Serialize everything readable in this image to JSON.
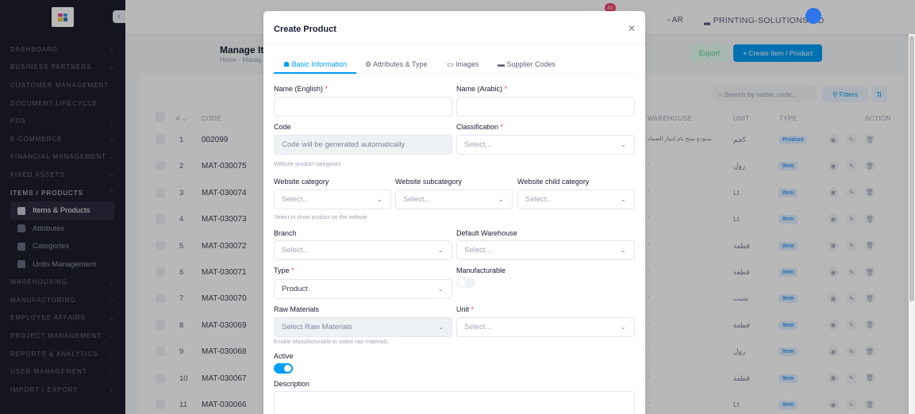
{
  "sidebar": {
    "sections": [
      {
        "label": "DASHBOARD"
      },
      {
        "label": "BUSINESS PARTNERS"
      },
      {
        "label": "CUSTOMER MANAGEMENT"
      },
      {
        "label": "DOCUMENT LIFECYCLE"
      },
      {
        "label": "POS"
      },
      {
        "label": "E-COMMERCE"
      },
      {
        "label": "FINANCIAL MANAGEMENT"
      },
      {
        "label": "FIXED ASSETS"
      },
      {
        "label": "ITEMS / PRODUCTS"
      }
    ],
    "items_sub": [
      {
        "label": "Items & Products"
      },
      {
        "label": "Attributes"
      },
      {
        "label": "Categories"
      },
      {
        "label": "Units Management"
      }
    ],
    "sections_after": [
      {
        "label": "WAREHOUSING"
      },
      {
        "label": "MANUFACTURING"
      },
      {
        "label": "EMPLOYEE AFFAIRS"
      },
      {
        "label": "PROJECT MANAGEMENT"
      },
      {
        "label": "REPORTS & ANALYTICS"
      },
      {
        "label": "USER MANAGEMENT"
      },
      {
        "label": "IMPORT / EXPORT"
      }
    ]
  },
  "topbar": {
    "notification_count": "41",
    "language": "AR",
    "company": "PRINTING-SOLUTIONS-CO"
  },
  "page": {
    "title": "Manage Ite",
    "breadcrumb": "Home - Manag",
    "export_label": "Export",
    "create_label": "+ Create Item / Product",
    "search_placeholder": "Search by name, code...",
    "filters_label": "Filters"
  },
  "table": {
    "headers": {
      "num": "#",
      "code": "CODE",
      "warehouse": "WAREHOUSE",
      "unit": "UNIT",
      "type": "TYPE",
      "action": "ACTION"
    },
    "rows": [
      {
        "num": "1",
        "code": "002099",
        "warehouse": "مستودع منتج تام أدوار الضماد",
        "unit": "كجم",
        "type": "Product"
      },
      {
        "num": "2",
        "code": "MAT-030075",
        "warehouse": "-",
        "unit": "رول",
        "type": "Item"
      },
      {
        "num": "3",
        "code": "MAT-030074",
        "warehouse": "-",
        "unit": "Lt",
        "type": "Item"
      },
      {
        "num": "4",
        "code": "MAT-030073",
        "warehouse": "-",
        "unit": "Lt",
        "type": "Item"
      },
      {
        "num": "5",
        "code": "MAT-030072",
        "warehouse": "-",
        "unit": "قطعة",
        "type": "Item"
      },
      {
        "num": "6",
        "code": "MAT-030071",
        "warehouse": "-",
        "unit": "قطعة",
        "type": "Item"
      },
      {
        "num": "7",
        "code": "MAT-030070",
        "warehouse": "-",
        "unit": "شيت",
        "type": "Item"
      },
      {
        "num": "8",
        "code": "MAT-030069",
        "warehouse": "-",
        "unit": "قطعة",
        "type": "Item"
      },
      {
        "num": "9",
        "code": "MAT-030068",
        "warehouse": "-",
        "unit": "رول",
        "type": "Item"
      },
      {
        "num": "10",
        "code": "MAT-030067",
        "warehouse": "-",
        "unit": "قطعة",
        "type": "Item"
      },
      {
        "num": "11",
        "code": "MAT-030066",
        "warehouse": "-",
        "unit": "Lt",
        "type": "Item"
      }
    ]
  },
  "modal": {
    "title": "Create Product",
    "tabs": [
      "Basic Information",
      "Attributes & Type",
      "Images",
      "Supplier Codes"
    ],
    "name_en_label": "Name (English)",
    "name_ar_label": "Name (Arabic)",
    "code_label": "Code",
    "code_placeholder": "Code will be generated automatically",
    "classification_label": "Classification",
    "classification_value": "Select...",
    "website_categories_hint": "Website product categories",
    "web_cat_label": "Website category",
    "web_subcat_label": "Website subcategory",
    "web_child_label": "Website child category",
    "web_cat_value": "Select...",
    "web_subcat_value": "Select...",
    "web_child_value": "Select...",
    "website_hint": "Select to show product on the website",
    "branch_label": "Branch",
    "branch_value": "Select...",
    "warehouse_label": "Default Warehouse",
    "warehouse_value": "Select...",
    "type_label": "Type",
    "type_value": "Product",
    "manufacturable_label": "Manufacturable",
    "manufacturable_on": false,
    "raw_label": "Raw Materials",
    "raw_value": "Select Raw Materials",
    "raw_hint": "Enable Manufacturable to select raw materials",
    "unit_label": "Unit",
    "unit_value": "Select...",
    "active_label": "Active",
    "active_on": true,
    "description_label": "Description"
  },
  "colors": {
    "accent": "#009ef7",
    "required": "#f1416c",
    "sidebar": "#1e1e2d"
  }
}
